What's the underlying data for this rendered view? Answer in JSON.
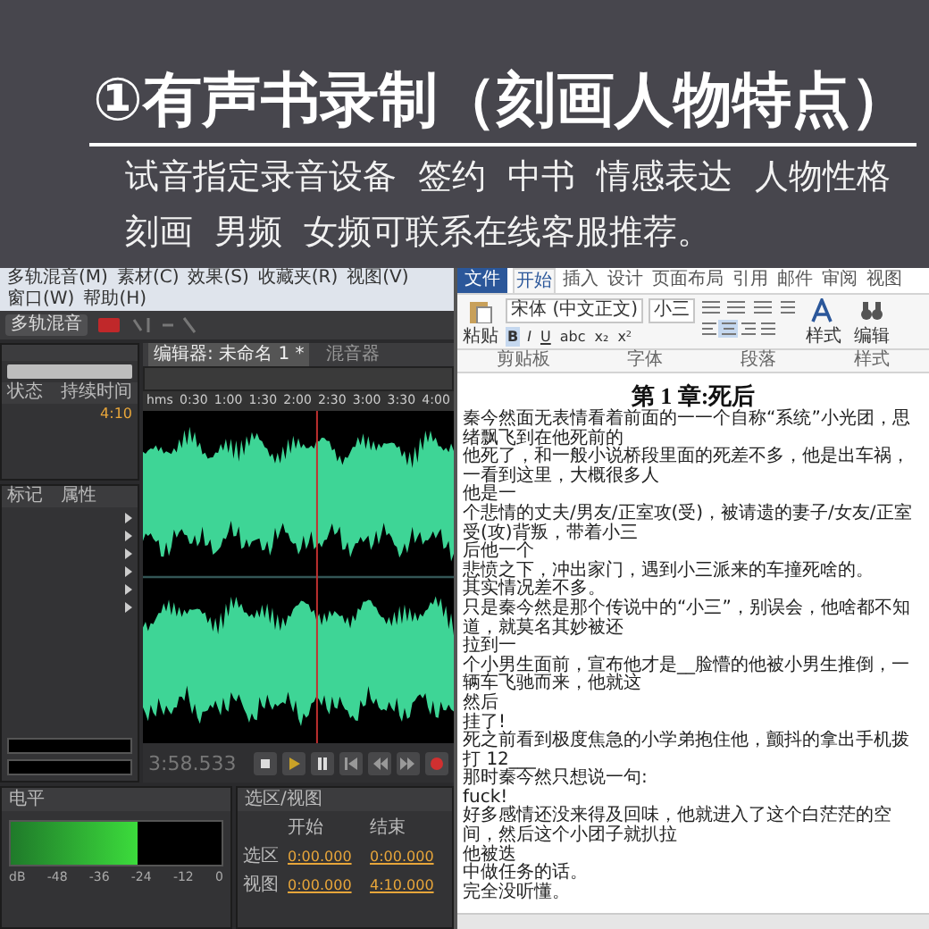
{
  "header": {
    "title": "①有声书录制（刻画人物特点）",
    "lines": [
      "试音指定录音设备  签约  中书  情感表达  人物性格",
      "刻画  男频  女频可联系在线客服推荐。"
    ]
  },
  "audition": {
    "menu": [
      "多轨混音(M)",
      "素材(C)",
      "效果(S)",
      "收藏夹(R)",
      "视图(V)",
      "窗口(W)",
      "帮助(H)"
    ],
    "toolbar_button": "多轨混音",
    "files_panel": {
      "columns": [
        "状态",
        "持续时间"
      ],
      "duration": "4:10"
    },
    "panel_tabs": [
      "标记",
      "属性"
    ],
    "editor_tabs": [
      {
        "label": "编辑器: 未命名 1 *",
        "selected": true
      },
      {
        "label": "混音器",
        "selected": false
      }
    ],
    "ruler": [
      "hms",
      "0:30",
      "1:00",
      "1:30",
      "2:00",
      "2:30",
      "3:00",
      "3:30",
      "4:00"
    ],
    "time": "3:58.533",
    "level_panel": {
      "title": "电平",
      "level": 0.6,
      "scale": [
        "dB",
        "-48",
        "-36",
        "-24",
        "-12",
        "0"
      ]
    },
    "selection_panel": {
      "title": "选区/视图",
      "columns": [
        "开始",
        "结束"
      ],
      "rows": [
        {
          "label": "选区",
          "start": "0:00.000",
          "end": "0:00.000"
        },
        {
          "label": "视图",
          "start": "0:00.000",
          "end": "4:10.000"
        }
      ]
    }
  },
  "word": {
    "file_tab": "文件",
    "tabs": [
      {
        "label": "开始",
        "selected": true
      },
      {
        "label": "插入",
        "selected": false
      },
      {
        "label": "设计",
        "selected": false
      },
      {
        "label": "页面布局",
        "selected": false
      },
      {
        "label": "引用",
        "selected": false
      },
      {
        "label": "邮件",
        "selected": false
      },
      {
        "label": "审阅",
        "selected": false
      },
      {
        "label": "视图",
        "selected": false
      }
    ],
    "font": "宋体 (中文正文)",
    "size": "小三",
    "format_buttons": [
      "B",
      "I",
      "U",
      "abc",
      "x₂",
      "x²"
    ],
    "paste": "粘贴",
    "styles": "样式",
    "editing": "编辑",
    "groups": [
      "剪贴板",
      "字体",
      "段落",
      "样式"
    ],
    "doc_title": "第 1 章:死后",
    "paragraphs": [
      "秦今然面无表情看着前面的一一个自称“系统”小光团，思绪飘飞到在他死前的",
      "他死了，和一般小说桥段里面的死差不多，他是出车祸，一看到这里，大概很多人",
      "他是一",
      "个悲情的丈夫/男友/正室攻(受)，被请遗的妻子/女友/正室受(攻)背叛，带着小三",
      "后他一个",
      "悲愤之下，冲出家门，遇到小三派来的车撞死啥的。",
      "其实情况差不多。",
      "只是秦今然是那个传说中的“小三”，别误会，他啥都不知道，就莫名其妙被还",
      "拉到一",
      "个小男生面前，宣布他才是__脸懵的他被小男生推倒，一辆车飞驰而来，他就这",
      "然后",
      "挂了!",
      "死之前看到极度焦急的小学弟抱住他，颤抖的拿出手机拨打 12___",
      "那时秦今然只想说一句:",
      "fuck!",
      "好多感情还没来得及回味，他就进入了这个白茫茫的空间，然后这个小团子就扒拉",
      "他被迭",
      "中做任务的话。",
      "完全没听懂。"
    ]
  }
}
